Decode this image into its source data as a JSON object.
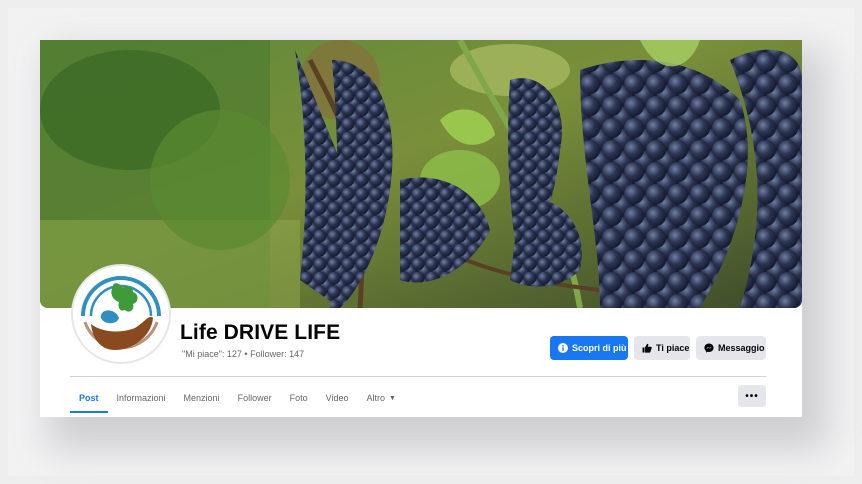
{
  "page": {
    "name": "Life DRIVE LIFE",
    "stats": "\"Mi piace\": 127 • Follower: 147"
  },
  "actions": {
    "primary_label": "Scopri di più",
    "like_label": "Ti piace",
    "message_label": "Messaggio",
    "more_label": "•••"
  },
  "tabs": [
    {
      "label": "Post",
      "active": true
    },
    {
      "label": "Informazioni"
    },
    {
      "label": "Menzioni"
    },
    {
      "label": "Follower"
    },
    {
      "label": "Foto"
    },
    {
      "label": "Video"
    },
    {
      "label": "Altro",
      "has_dropdown": true
    }
  ],
  "colors": {
    "accent": "#1877f2",
    "secondary_button": "#e4e6eb",
    "logo_blue": "#2f8fbf",
    "logo_green": "#3f9a3a",
    "logo_brown": "#8a4a1f"
  },
  "icons": {
    "primary": "info-icon",
    "like": "thumbs-up-icon",
    "message": "messenger-icon",
    "altro_caret": "caret-down-icon"
  }
}
